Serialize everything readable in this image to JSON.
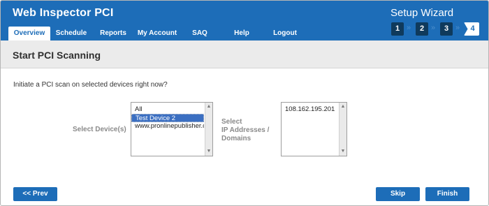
{
  "header": {
    "app_title": "Web Inspector PCI",
    "wizard_title": "Setup Wizard"
  },
  "tabs": [
    {
      "label": "Overview",
      "active": true
    },
    {
      "label": "Schedule",
      "active": false
    },
    {
      "label": "Reports",
      "active": false
    },
    {
      "label": "My Account",
      "active": false
    },
    {
      "label": "SAQ",
      "active": false
    },
    {
      "label": "Help",
      "active": false
    },
    {
      "label": "Logout",
      "active": false
    }
  ],
  "wizard_steps": {
    "steps": [
      "1",
      "2",
      "3",
      "4"
    ],
    "current": "4",
    "separator": "»"
  },
  "section": {
    "title": "Start PCI Scanning"
  },
  "intro_text": "Initiate a PCI scan on selected devices right now?",
  "devices": {
    "label": "Select Device(s)",
    "options": [
      "All",
      "Test Device 2",
      "www.pronlinepublisher.com"
    ],
    "selected": "Test Device 2"
  },
  "ip_addresses": {
    "label_line1": "Select",
    "label_line2": "IP Addresses /",
    "label_line3": "Domains",
    "options": [
      "108.162.195.201"
    ]
  },
  "scrollbar": {
    "up_glyph": "▲",
    "down_glyph": "▼"
  },
  "buttons": {
    "prev": "<< Prev",
    "skip": "Skip",
    "finish": "Finish"
  },
  "colors": {
    "brand_blue": "#1d6db8",
    "step_dark": "#0f3a5c",
    "section_bg": "#ebebeb",
    "selection": "#3b6fc2"
  }
}
